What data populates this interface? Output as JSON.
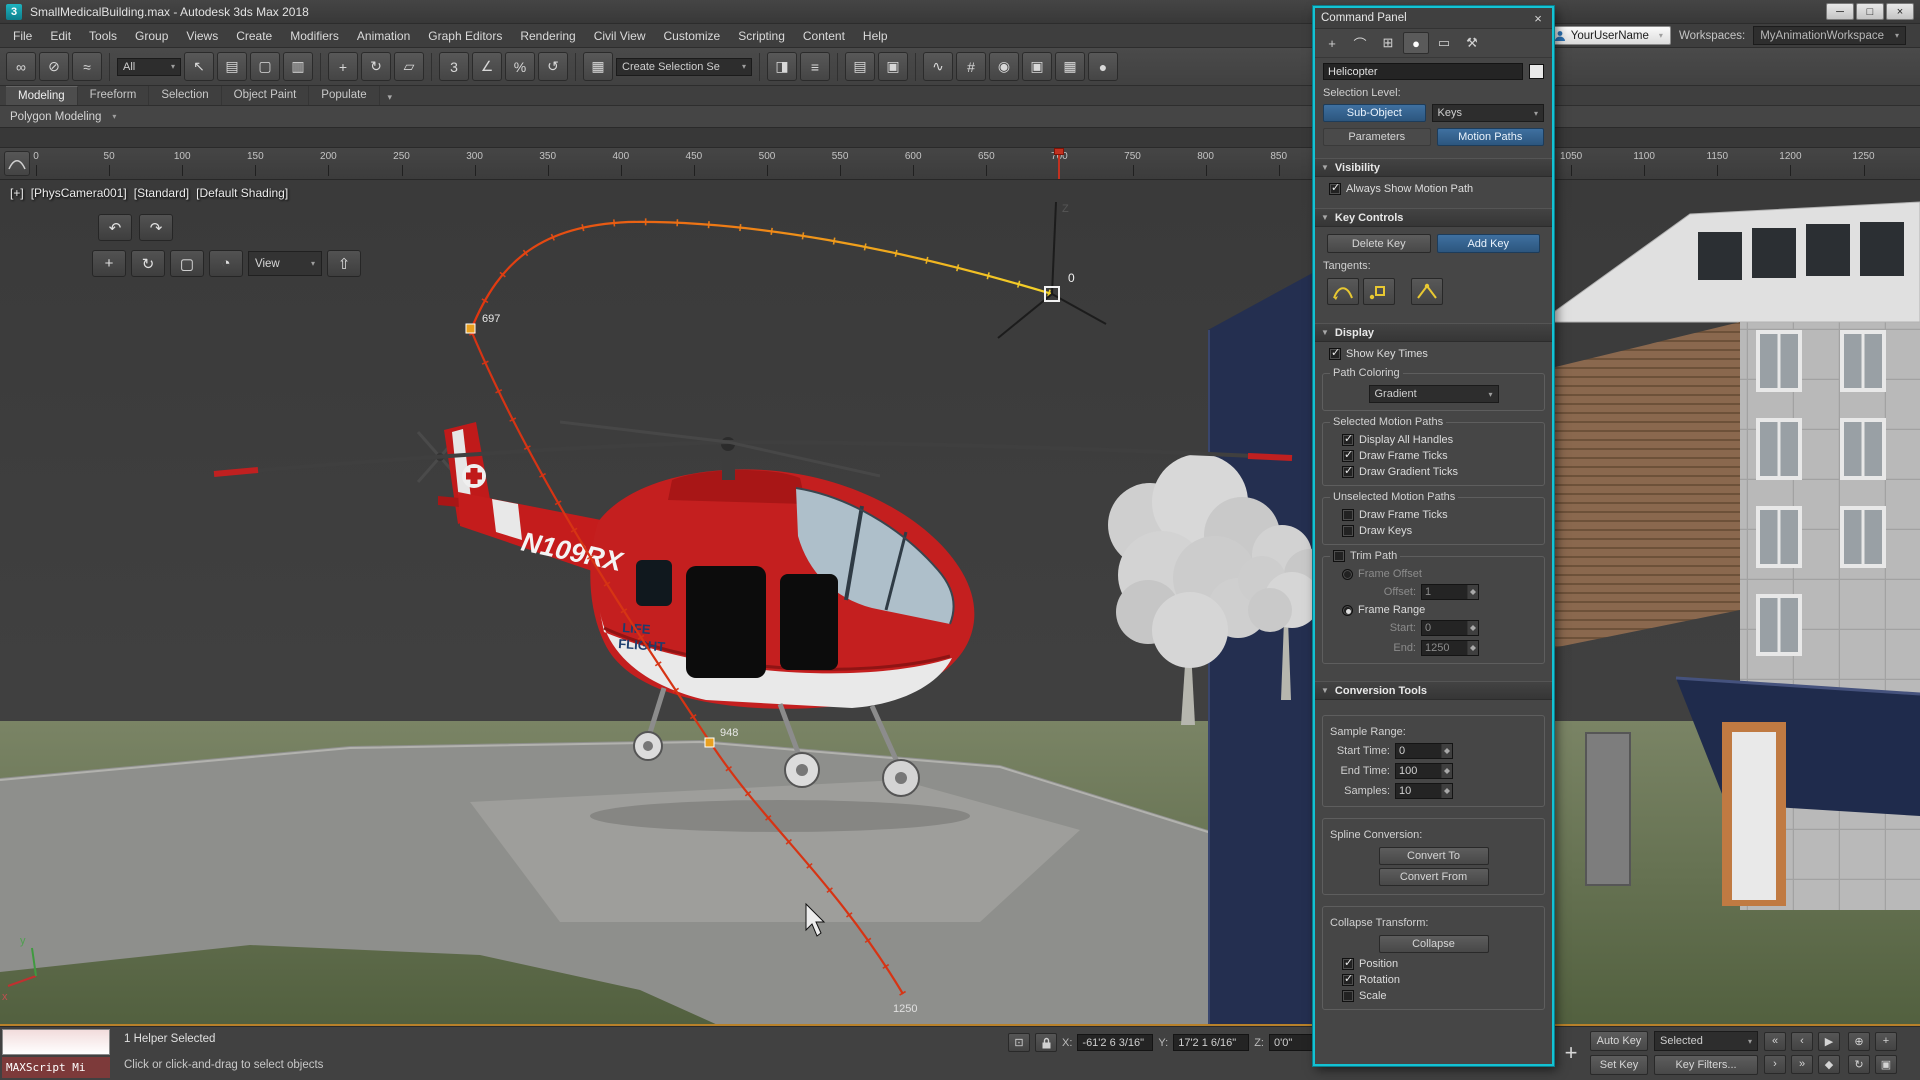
{
  "colors": {
    "accent_teal": "#14c2d3",
    "path_red": "#d63414",
    "path_yellow": "#f4d42a",
    "key_orange": "#e8a020",
    "active_blue": "#2c567e",
    "heli_red": "#c41f1f",
    "ground_green": "#70805f",
    "navy": "#232e4e"
  },
  "window": {
    "title": "SmallMedicalBuilding.max - Autodesk 3ds Max 2018",
    "app_icon": "3",
    "minimize": "─",
    "maximize": "□",
    "close": "×"
  },
  "menu": {
    "items": [
      "File",
      "Edit",
      "Tools",
      "Group",
      "Views",
      "Create",
      "Modifiers",
      "Animation",
      "Graph Editors",
      "Rendering",
      "Civil View",
      "Customize",
      "Scripting",
      "Content",
      "Help"
    ]
  },
  "account": {
    "user_name": "YourUserName",
    "workspaces_label": "Workspaces:",
    "workspace": "MyAnimationWorkspace"
  },
  "toolbar": {
    "items": [
      {
        "n": "select-and-link",
        "g": "∞"
      },
      {
        "n": "unlink-selection",
        "g": "⊘"
      },
      {
        "n": "bind-to-space-warp",
        "g": "≈"
      },
      {
        "t": "sep"
      },
      {
        "n": "selection-filter",
        "t": "dd",
        "label": "All",
        "w": 64
      },
      {
        "n": "select-object",
        "g": "↖"
      },
      {
        "n": "select-by-name",
        "g": "▤"
      },
      {
        "n": "rectangular-selection-region",
        "g": "▢"
      },
      {
        "n": "window-crossing-toggle",
        "g": "▥"
      },
      {
        "t": "sep"
      },
      {
        "n": "select-and-move",
        "g": "+"
      },
      {
        "n": "select-and-rotate",
        "g": "↻"
      },
      {
        "n": "select-and-scale",
        "g": "▱"
      },
      {
        "t": "sep"
      },
      {
        "n": "snaps-toggle",
        "g": "3"
      },
      {
        "n": "angle-snap-toggle",
        "g": "∠"
      },
      {
        "n": "percent-snap-toggle",
        "g": "%"
      },
      {
        "n": "spinner-snap-toggle",
        "g": "↺"
      },
      {
        "t": "sep"
      },
      {
        "n": "edit-named-selection-sets",
        "g": "▦"
      },
      {
        "n": "named-selection-sets",
        "t": "dd",
        "label": "Create Selection Se",
        "w": 136
      },
      {
        "t": "sep"
      },
      {
        "n": "mirror",
        "g": "◨"
      },
      {
        "n": "align",
        "g": "≡"
      },
      {
        "t": "sep"
      },
      {
        "n": "toggle-scene-explorer",
        "g": "▤"
      },
      {
        "n": "toggle-layer-explorer",
        "g": "▣"
      },
      {
        "t": "sep"
      },
      {
        "n": "curve-editor",
        "g": "∿"
      },
      {
        "n": "schematic-view",
        "g": "#"
      },
      {
        "n": "material-editor",
        "g": "◉"
      },
      {
        "n": "render-setup",
        "g": "▣"
      },
      {
        "n": "rendered-frame-window",
        "g": "▦"
      },
      {
        "n": "render-production",
        "g": "●"
      }
    ]
  },
  "ribbon": {
    "tabs": [
      "Modeling",
      "Freeform",
      "Selection",
      "Object Paint",
      "Populate"
    ],
    "active": "Modeling",
    "options_arrow": "▾",
    "subpanel": "Polygon Modeling",
    "subpanel_arrow": "▾"
  },
  "timeline": {
    "start": 0,
    "end": 1250,
    "step": 50,
    "current_frame": 700
  },
  "viewport": {
    "label_general": "[+]",
    "label_camera": "[PhysCamera001]",
    "label_renderer": "[Standard]",
    "label_shading": "[Default Shading]",
    "undo_glyph": "↶",
    "redo_glyph": "↷",
    "view_dropdown": "View",
    "mini_toolbar": {
      "icons_before": [
        {
          "n": "move-tool-icon",
          "g": "+"
        },
        {
          "n": "rotate-tool-icon",
          "g": "↻"
        },
        {
          "n": "region-tool-icon",
          "g": "▢"
        },
        {
          "n": "orbit-tool-icon",
          "g": "◔"
        }
      ],
      "icons_after": [
        {
          "n": "maximize-tool-icon",
          "g": "⇧"
        }
      ]
    },
    "helicopter": {
      "registration": "N109RX",
      "livery_line1": "LIFE",
      "livery_line2": "FLIGHT"
    },
    "motion_path": {
      "key_start": "0",
      "key_mid": "697",
      "key_low": "948",
      "key_end": "1250"
    },
    "axis": {
      "x": "x",
      "y": "y",
      "z": "Z"
    }
  },
  "command_panel": {
    "title": "Command Panel",
    "close": "×",
    "tabs": [
      {
        "n": "create-tab-icon",
        "g": "+"
      },
      {
        "n": "modify-tab-icon",
        "g": "⌒"
      },
      {
        "n": "hierarchy-tab-icon",
        "g": "⊞"
      },
      {
        "n": "motion-tab-icon",
        "g": "●",
        "active": true
      },
      {
        "n": "display-tab-icon",
        "g": "▭"
      },
      {
        "n": "utilities-tab-icon",
        "g": "⚒"
      }
    ],
    "object_name": "Helicopter",
    "selection_level_label": "Selection Level:",
    "sub_object": "Sub-Object",
    "keys_dropdown": "Keys",
    "parameters": "Parameters",
    "motion_paths": "Motion Paths",
    "visibility": {
      "title": "Visibility",
      "always_show": "Always Show Motion Path",
      "always_show_checked": true
    },
    "key_controls": {
      "title": "Key Controls",
      "delete_key": "Delete Key",
      "add_key": "Add Key",
      "tangents_label": "Tangents:"
    },
    "display": {
      "title": "Display",
      "show_key_times": "Show Key Times",
      "show_key_times_checked": true,
      "path_coloring_label": "Path Coloring",
      "gradient_dropdown": "Gradient",
      "selected_group": "Selected Motion Paths",
      "display_all_handles": "Display All Handles",
      "display_all_handles_checked": true,
      "draw_frame_ticks": "Draw Frame Ticks",
      "draw_frame_ticks_checked": true,
      "draw_gradient_ticks": "Draw Gradient Ticks",
      "draw_gradient_ticks_checked": true,
      "unselected_group": "Unselected Motion Paths",
      "u_draw_frame_ticks": "Draw Frame Ticks",
      "u_draw_frame_ticks_checked": false,
      "u_draw_keys": "Draw Keys",
      "u_draw_keys_checked": false,
      "trim_path": "Trim Path",
      "trim_path_checked": false,
      "frame_offset": "Frame Offset",
      "frame_offset_selected": false,
      "offset_label": "Offset:",
      "offset_value": "1",
      "frame_range": "Frame Range",
      "frame_range_selected": true,
      "start_label": "Start:",
      "start_value": "0",
      "end_label": "End:",
      "end_value": "1250"
    },
    "conversion": {
      "title": "Conversion Tools",
      "sample_range": "Sample Range:",
      "start_time_label": "Start Time:",
      "start_time": "0",
      "end_time_label": "End Time:",
      "end_time": "100",
      "samples_label": "Samples:",
      "samples": "10",
      "spline_conversion": "Spline Conversion:",
      "convert_to": "Convert To",
      "convert_from": "Convert From",
      "collapse_transform": "Collapse Transform:",
      "collapse": "Collapse",
      "position": "Position",
      "position_checked": true,
      "rotation": "Rotation",
      "rotation_checked": true,
      "scale": "Scale",
      "scale_checked": false
    }
  },
  "status": {
    "maxscript_label": "MAXScript Mi",
    "selection_info": "1 Helper Selected",
    "prompt": "Click or click-and-drag to select objects",
    "coordinates": {
      "x_label": "X:",
      "x_value": "-61'2 6 3/16\"",
      "y_label": "Y:",
      "y_value": "17'2 1 6/16\"",
      "z_label": "Z:",
      "z_value": "0'0\""
    },
    "animation": {
      "auto_key": "Auto Key",
      "set_key": "Set Key",
      "selected_filter": "Selected",
      "key_filters": "Key Filters..."
    },
    "transport": [
      {
        "n": "go-to-start",
        "g": "«"
      },
      {
        "n": "previous-frame",
        "g": "‹"
      },
      {
        "n": "play-animation",
        "g": "▶"
      },
      {
        "n": "next-frame",
        "g": "›"
      },
      {
        "n": "go-to-end",
        "g": "»"
      },
      {
        "n": "key-mode-toggle",
        "g": "◆"
      }
    ],
    "nav": [
      {
        "n": "zoom",
        "g": "⊕"
      },
      {
        "n": "pan-view",
        "g": "+"
      },
      {
        "n": "orbit-view",
        "g": "↻"
      },
      {
        "n": "maximize-viewport-toggle",
        "g": "▣"
      }
    ]
  }
}
